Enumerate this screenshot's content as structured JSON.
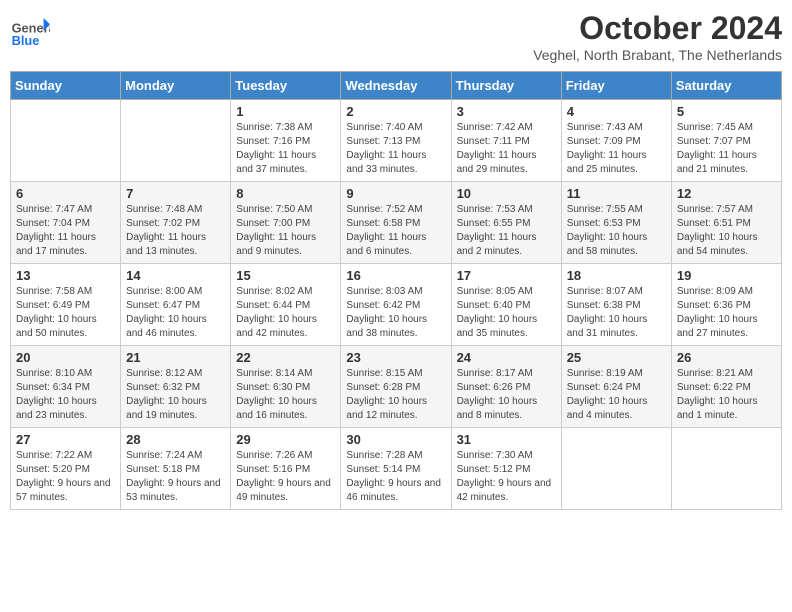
{
  "header": {
    "logo_general": "General",
    "logo_blue": "Blue",
    "month": "October 2024",
    "location": "Veghel, North Brabant, The Netherlands"
  },
  "days_of_week": [
    "Sunday",
    "Monday",
    "Tuesday",
    "Wednesday",
    "Thursday",
    "Friday",
    "Saturday"
  ],
  "weeks": [
    [
      {
        "day": "",
        "sunrise": "",
        "sunset": "",
        "daylight": ""
      },
      {
        "day": "",
        "sunrise": "",
        "sunset": "",
        "daylight": ""
      },
      {
        "day": "1",
        "sunrise": "Sunrise: 7:38 AM",
        "sunset": "Sunset: 7:16 PM",
        "daylight": "Daylight: 11 hours and 37 minutes."
      },
      {
        "day": "2",
        "sunrise": "Sunrise: 7:40 AM",
        "sunset": "Sunset: 7:13 PM",
        "daylight": "Daylight: 11 hours and 33 minutes."
      },
      {
        "day": "3",
        "sunrise": "Sunrise: 7:42 AM",
        "sunset": "Sunset: 7:11 PM",
        "daylight": "Daylight: 11 hours and 29 minutes."
      },
      {
        "day": "4",
        "sunrise": "Sunrise: 7:43 AM",
        "sunset": "Sunset: 7:09 PM",
        "daylight": "Daylight: 11 hours and 25 minutes."
      },
      {
        "day": "5",
        "sunrise": "Sunrise: 7:45 AM",
        "sunset": "Sunset: 7:07 PM",
        "daylight": "Daylight: 11 hours and 21 minutes."
      }
    ],
    [
      {
        "day": "6",
        "sunrise": "Sunrise: 7:47 AM",
        "sunset": "Sunset: 7:04 PM",
        "daylight": "Daylight: 11 hours and 17 minutes."
      },
      {
        "day": "7",
        "sunrise": "Sunrise: 7:48 AM",
        "sunset": "Sunset: 7:02 PM",
        "daylight": "Daylight: 11 hours and 13 minutes."
      },
      {
        "day": "8",
        "sunrise": "Sunrise: 7:50 AM",
        "sunset": "Sunset: 7:00 PM",
        "daylight": "Daylight: 11 hours and 9 minutes."
      },
      {
        "day": "9",
        "sunrise": "Sunrise: 7:52 AM",
        "sunset": "Sunset: 6:58 PM",
        "daylight": "Daylight: 11 hours and 6 minutes."
      },
      {
        "day": "10",
        "sunrise": "Sunrise: 7:53 AM",
        "sunset": "Sunset: 6:55 PM",
        "daylight": "Daylight: 11 hours and 2 minutes."
      },
      {
        "day": "11",
        "sunrise": "Sunrise: 7:55 AM",
        "sunset": "Sunset: 6:53 PM",
        "daylight": "Daylight: 10 hours and 58 minutes."
      },
      {
        "day": "12",
        "sunrise": "Sunrise: 7:57 AM",
        "sunset": "Sunset: 6:51 PM",
        "daylight": "Daylight: 10 hours and 54 minutes."
      }
    ],
    [
      {
        "day": "13",
        "sunrise": "Sunrise: 7:58 AM",
        "sunset": "Sunset: 6:49 PM",
        "daylight": "Daylight: 10 hours and 50 minutes."
      },
      {
        "day": "14",
        "sunrise": "Sunrise: 8:00 AM",
        "sunset": "Sunset: 6:47 PM",
        "daylight": "Daylight: 10 hours and 46 minutes."
      },
      {
        "day": "15",
        "sunrise": "Sunrise: 8:02 AM",
        "sunset": "Sunset: 6:44 PM",
        "daylight": "Daylight: 10 hours and 42 minutes."
      },
      {
        "day": "16",
        "sunrise": "Sunrise: 8:03 AM",
        "sunset": "Sunset: 6:42 PM",
        "daylight": "Daylight: 10 hours and 38 minutes."
      },
      {
        "day": "17",
        "sunrise": "Sunrise: 8:05 AM",
        "sunset": "Sunset: 6:40 PM",
        "daylight": "Daylight: 10 hours and 35 minutes."
      },
      {
        "day": "18",
        "sunrise": "Sunrise: 8:07 AM",
        "sunset": "Sunset: 6:38 PM",
        "daylight": "Daylight: 10 hours and 31 minutes."
      },
      {
        "day": "19",
        "sunrise": "Sunrise: 8:09 AM",
        "sunset": "Sunset: 6:36 PM",
        "daylight": "Daylight: 10 hours and 27 minutes."
      }
    ],
    [
      {
        "day": "20",
        "sunrise": "Sunrise: 8:10 AM",
        "sunset": "Sunset: 6:34 PM",
        "daylight": "Daylight: 10 hours and 23 minutes."
      },
      {
        "day": "21",
        "sunrise": "Sunrise: 8:12 AM",
        "sunset": "Sunset: 6:32 PM",
        "daylight": "Daylight: 10 hours and 19 minutes."
      },
      {
        "day": "22",
        "sunrise": "Sunrise: 8:14 AM",
        "sunset": "Sunset: 6:30 PM",
        "daylight": "Daylight: 10 hours and 16 minutes."
      },
      {
        "day": "23",
        "sunrise": "Sunrise: 8:15 AM",
        "sunset": "Sunset: 6:28 PM",
        "daylight": "Daylight: 10 hours and 12 minutes."
      },
      {
        "day": "24",
        "sunrise": "Sunrise: 8:17 AM",
        "sunset": "Sunset: 6:26 PM",
        "daylight": "Daylight: 10 hours and 8 minutes."
      },
      {
        "day": "25",
        "sunrise": "Sunrise: 8:19 AM",
        "sunset": "Sunset: 6:24 PM",
        "daylight": "Daylight: 10 hours and 4 minutes."
      },
      {
        "day": "26",
        "sunrise": "Sunrise: 8:21 AM",
        "sunset": "Sunset: 6:22 PM",
        "daylight": "Daylight: 10 hours and 1 minute."
      }
    ],
    [
      {
        "day": "27",
        "sunrise": "Sunrise: 7:22 AM",
        "sunset": "Sunset: 5:20 PM",
        "daylight": "Daylight: 9 hours and 57 minutes."
      },
      {
        "day": "28",
        "sunrise": "Sunrise: 7:24 AM",
        "sunset": "Sunset: 5:18 PM",
        "daylight": "Daylight: 9 hours and 53 minutes."
      },
      {
        "day": "29",
        "sunrise": "Sunrise: 7:26 AM",
        "sunset": "Sunset: 5:16 PM",
        "daylight": "Daylight: 9 hours and 49 minutes."
      },
      {
        "day": "30",
        "sunrise": "Sunrise: 7:28 AM",
        "sunset": "Sunset: 5:14 PM",
        "daylight": "Daylight: 9 hours and 46 minutes."
      },
      {
        "day": "31",
        "sunrise": "Sunrise: 7:30 AM",
        "sunset": "Sunset: 5:12 PM",
        "daylight": "Daylight: 9 hours and 42 minutes."
      },
      {
        "day": "",
        "sunrise": "",
        "sunset": "",
        "daylight": ""
      },
      {
        "day": "",
        "sunrise": "",
        "sunset": "",
        "daylight": ""
      }
    ]
  ]
}
